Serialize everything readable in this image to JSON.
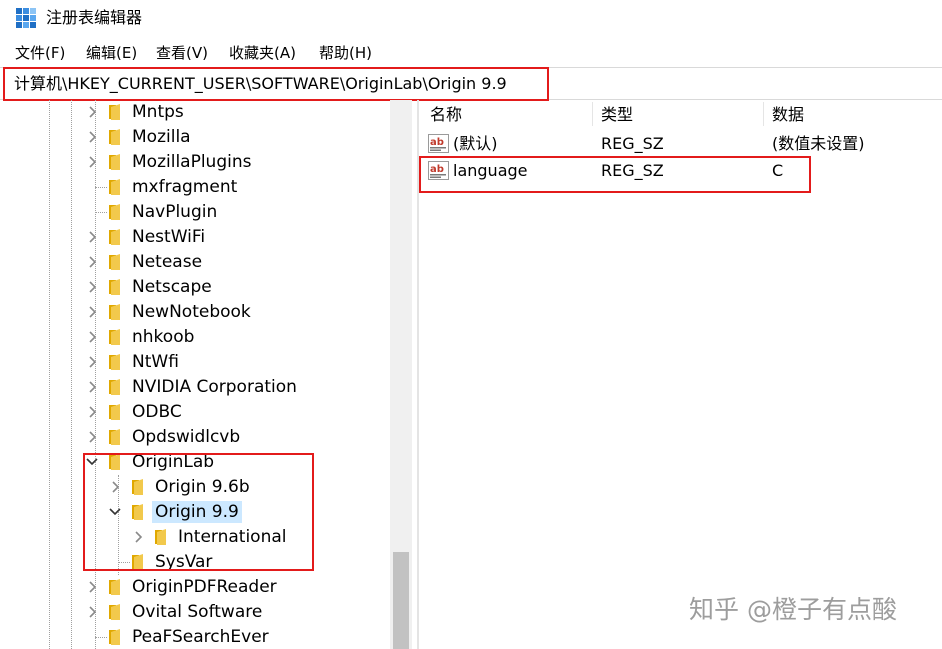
{
  "window": {
    "title": "注册表编辑器"
  },
  "menu": [
    "文件(F)",
    "编辑(E)",
    "查看(V)",
    "收藏夹(A)",
    "帮助(H)"
  ],
  "address": {
    "path": "计算机\\HKEY_CURRENT_USER\\SOFTWARE\\OriginLab\\Origin 9.9"
  },
  "tree": {
    "items": [
      {
        "label": "Mntps",
        "expander": "collapsed"
      },
      {
        "label": "Mozilla",
        "expander": "collapsed"
      },
      {
        "label": "MozillaPlugins",
        "expander": "collapsed"
      },
      {
        "label": "mxfragment",
        "expander": "none"
      },
      {
        "label": "NavPlugin",
        "expander": "none"
      },
      {
        "label": "NestWiFi",
        "expander": "collapsed"
      },
      {
        "label": "Netease",
        "expander": "collapsed"
      },
      {
        "label": "Netscape",
        "expander": "collapsed"
      },
      {
        "label": "NewNotebook",
        "expander": "collapsed"
      },
      {
        "label": "nhkoob",
        "expander": "collapsed"
      },
      {
        "label": "NtWfi",
        "expander": "collapsed"
      },
      {
        "label": "NVIDIA Corporation",
        "expander": "collapsed"
      },
      {
        "label": "ODBC",
        "expander": "collapsed"
      },
      {
        "label": "Opdswidlcvb",
        "expander": "collapsed"
      },
      {
        "label": "OriginLab",
        "expander": "expanded"
      },
      {
        "label": "Origin 9.6b",
        "expander": "collapsed"
      },
      {
        "label": "Origin 9.9",
        "expander": "expanded",
        "selected": true
      },
      {
        "label": "International",
        "expander": "collapsed"
      },
      {
        "label": "SysVar",
        "expander": "none"
      },
      {
        "label": "OriginPDFReader",
        "expander": "collapsed"
      },
      {
        "label": "Ovital Software",
        "expander": "collapsed"
      },
      {
        "label": "PeaFSearchEver",
        "expander": "none"
      }
    ]
  },
  "values": {
    "headers": {
      "name": "名称",
      "type": "类型",
      "data": "数据"
    },
    "rows": [
      {
        "icon": "string-value-icon",
        "name": "(默认)",
        "type": "REG_SZ",
        "data": "(数值未设置)"
      },
      {
        "icon": "string-value-icon",
        "name": "language",
        "type": "REG_SZ",
        "data": "C"
      }
    ]
  },
  "watermark": "知乎 @橙子有点酸",
  "colors": {
    "highlight_box": "#e31b1b",
    "selection": "#cce8ff",
    "folder": "#f2c94c"
  }
}
